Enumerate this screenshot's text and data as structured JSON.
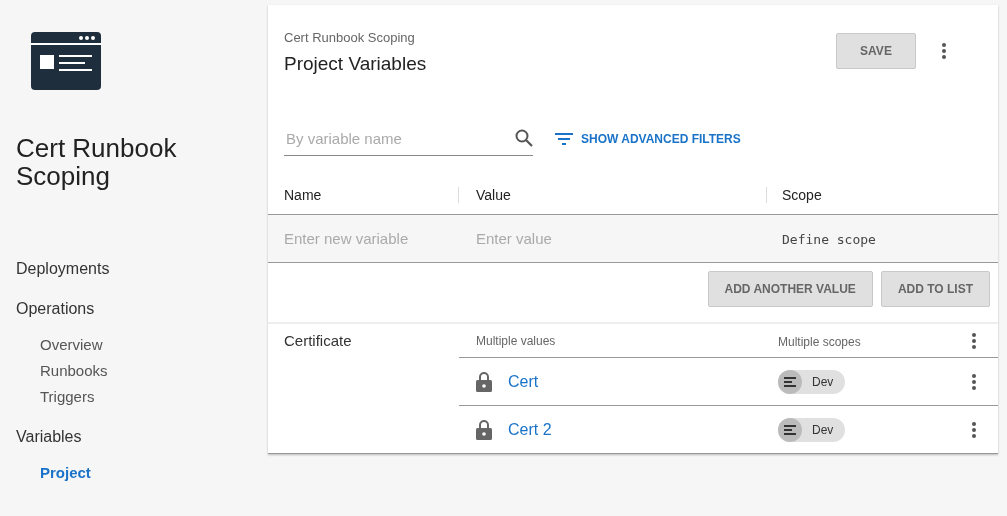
{
  "sidebar": {
    "project_name": "Cert Runbook Scoping",
    "nav": [
      {
        "label": "Deployments",
        "selected": false
      },
      {
        "label": "Operations",
        "selected": false,
        "children": [
          {
            "label": "Overview",
            "selected": false
          },
          {
            "label": "Runbooks",
            "selected": false
          },
          {
            "label": "Triggers",
            "selected": false
          }
        ]
      },
      {
        "label": "Variables",
        "selected": false,
        "children": [
          {
            "label": "Project",
            "selected": true
          }
        ]
      }
    ]
  },
  "header": {
    "breadcrumb": "Cert Runbook Scoping",
    "title": "Project Variables",
    "save_button": "SAVE"
  },
  "filter": {
    "placeholder": "By variable name",
    "advanced_filters": "SHOW ADVANCED FILTERS"
  },
  "table": {
    "columns": [
      "Name",
      "Value",
      "Scope"
    ],
    "new_row": {
      "name_placeholder": "Enter new variable",
      "value_placeholder": "Enter value",
      "scope": "Define scope"
    },
    "buttons": [
      "ADD ANOTHER VALUE",
      "ADD TO LIST"
    ],
    "variables": [
      {
        "name": "Certificate",
        "values_label": "Multiple values",
        "scopes_label": "Multiple scopes",
        "values": [
          {
            "value": "Cert",
            "scope": "Dev"
          },
          {
            "value": "Cert 2",
            "scope": "Dev"
          }
        ]
      }
    ]
  }
}
